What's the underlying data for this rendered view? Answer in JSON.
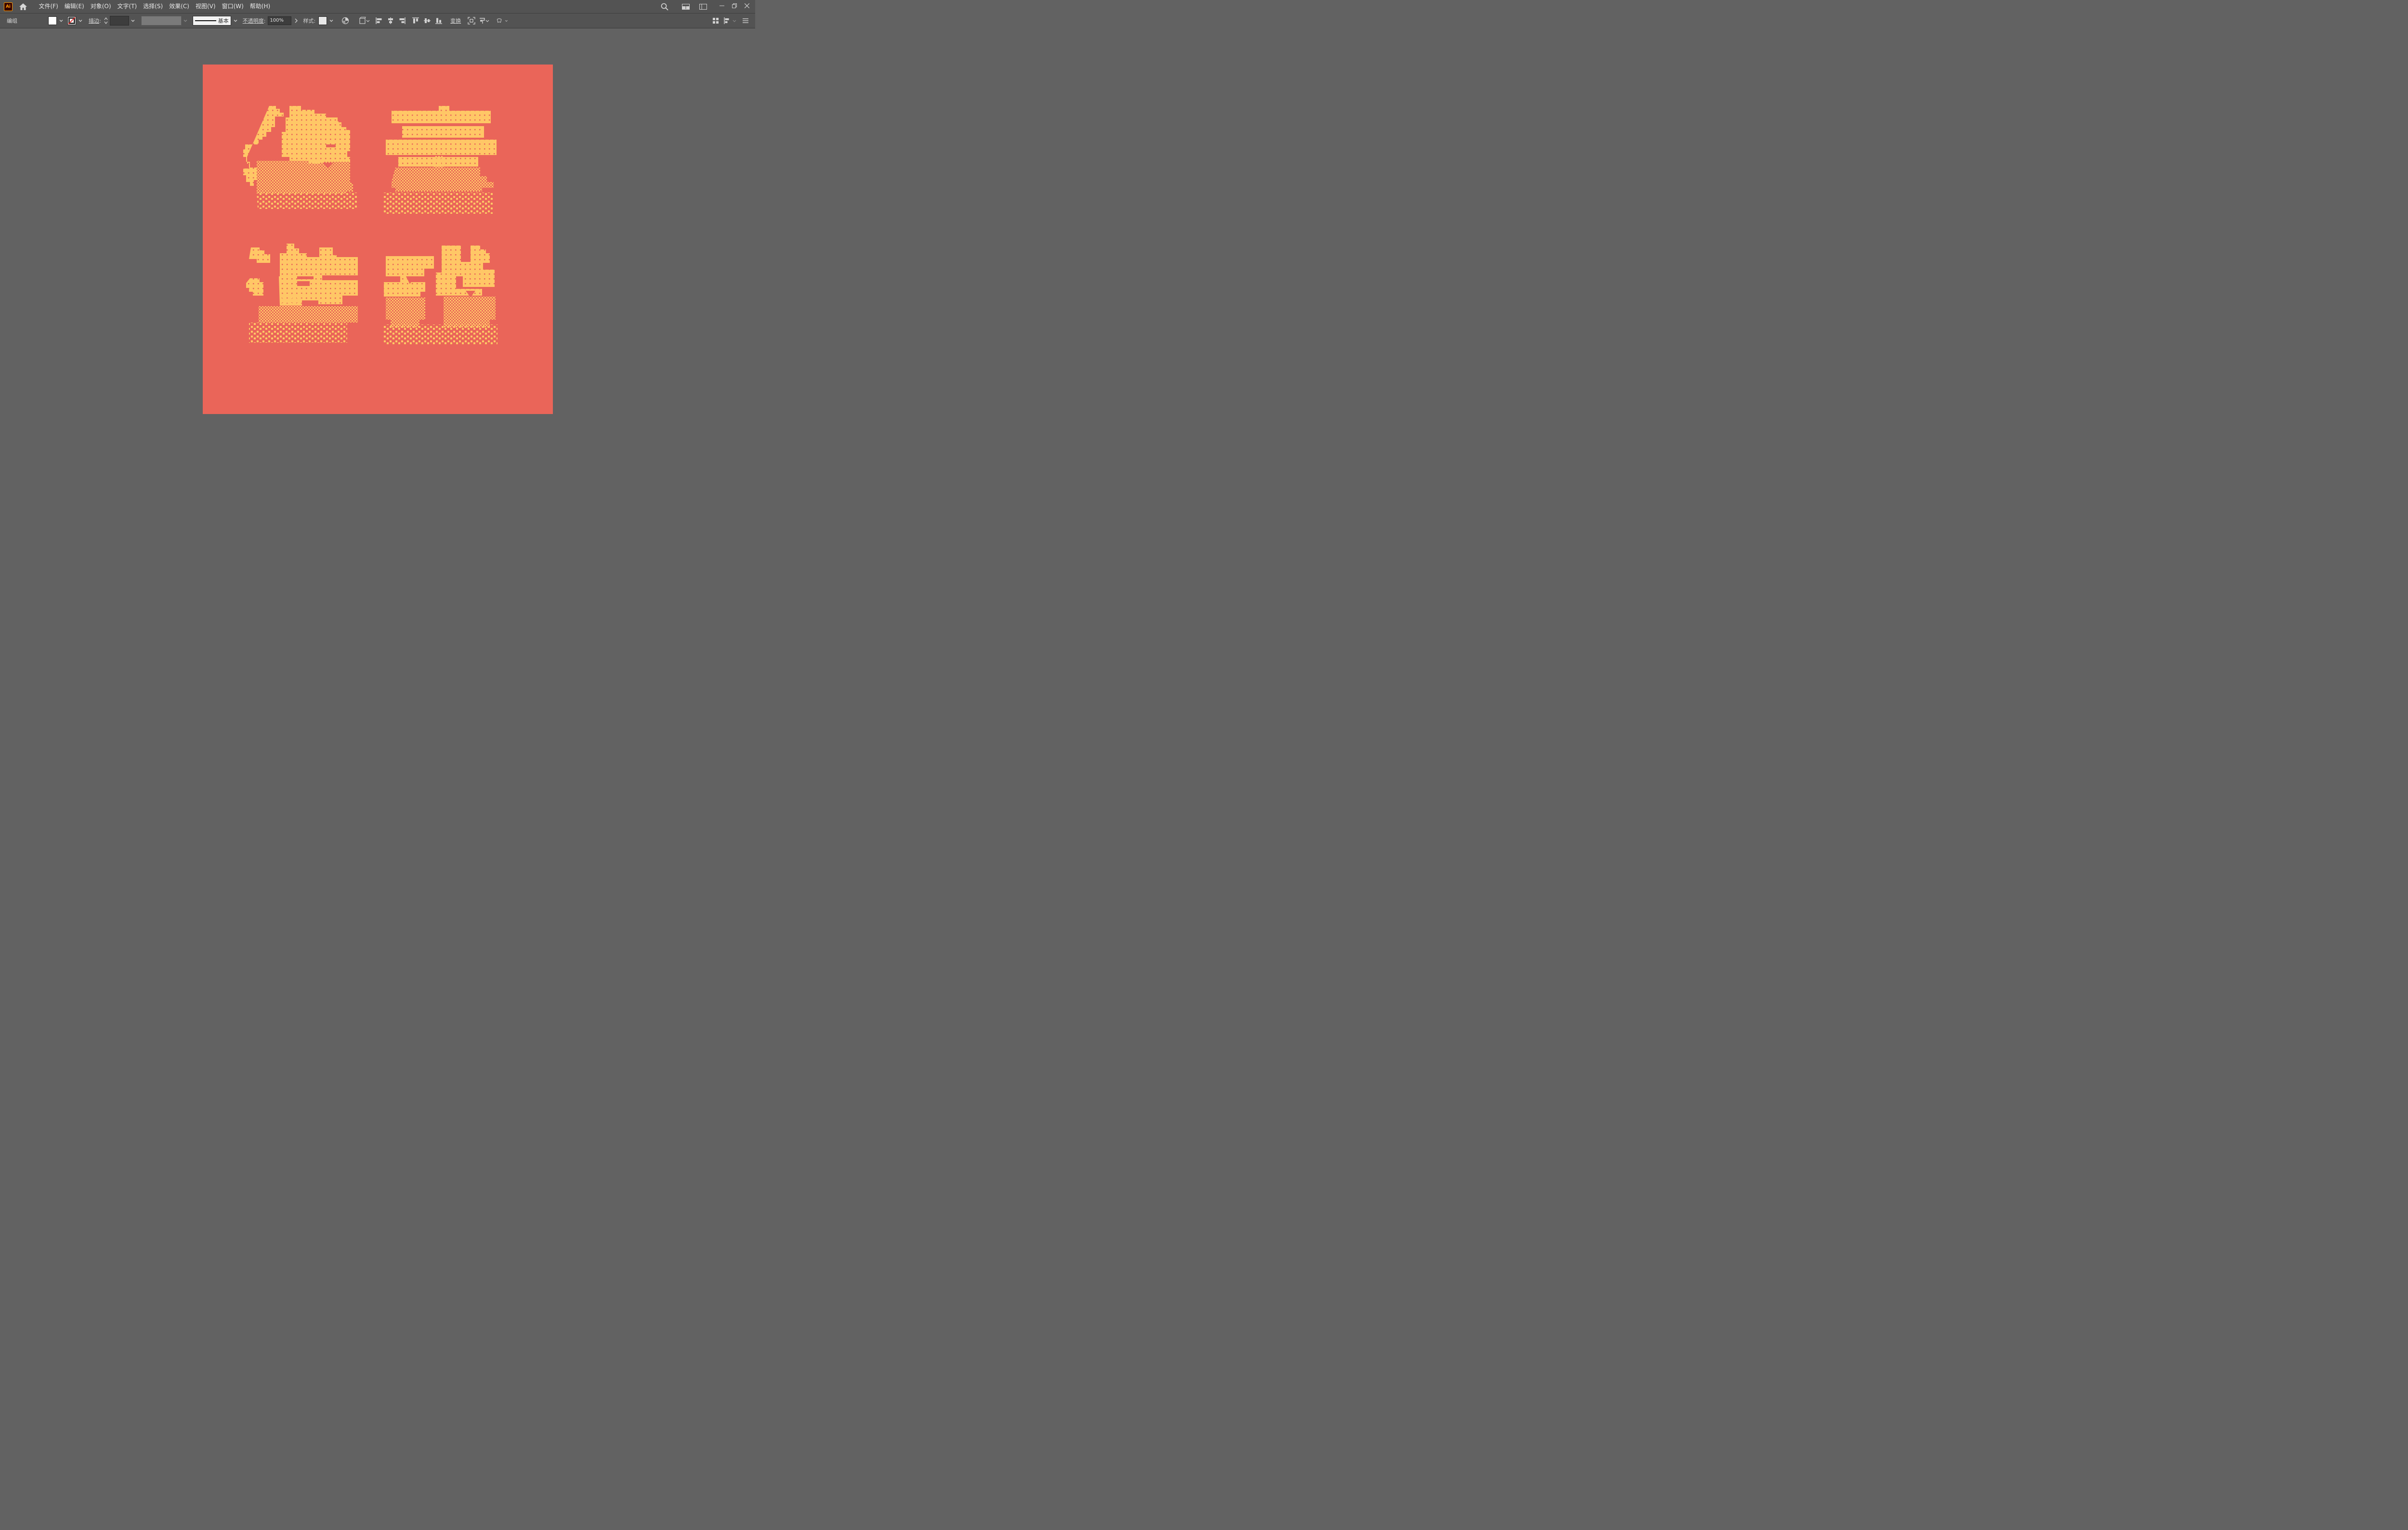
{
  "app": {
    "logo_text": "Ai"
  },
  "menu": [
    "文件(F)",
    "编辑(E)",
    "对象(O)",
    "文字(T)",
    "选择(S)",
    "效果(C)",
    "视图(V)",
    "窗口(W)",
    "帮助(H)"
  ],
  "control": {
    "selection_type": "编组",
    "fill_color": "#ffffff",
    "stroke_label": "描边",
    "stroke_profile": "基本",
    "opacity_label": "不透明度",
    "opacity_value": "100%",
    "style_label": "样式",
    "transform_label": "变换"
  },
  "colors": {
    "workspace": "#626262",
    "artboard": "#ea6559",
    "glyph": "#ffc766"
  },
  "icons": [
    "home-icon",
    "search-icon",
    "workspace-icon",
    "panel-icon",
    "minimize-icon",
    "restore-icon",
    "close-icon",
    "recolor-icon",
    "shape-icon",
    "align-left-icon",
    "align-hcenter-icon",
    "align-right-icon",
    "align-top-icon",
    "align-vcenter-icon",
    "align-bottom-icon",
    "isolate-icon",
    "puppet-icon",
    "envelope-icon",
    "arrange-icon",
    "panel-menu-icon"
  ]
}
